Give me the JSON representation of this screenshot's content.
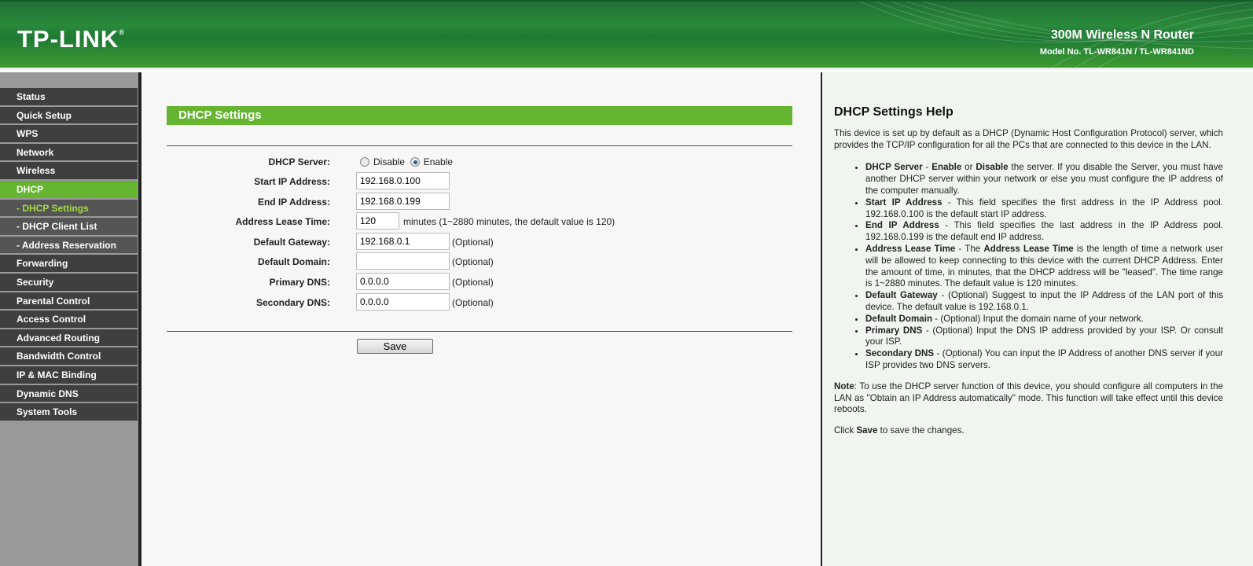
{
  "header": {
    "logo": "TP-LINK",
    "product": "300M Wireless N Router",
    "model": "Model No. TL-WR841N / TL-WR841ND",
    "brand_color": "#2a8a3a"
  },
  "sidebar": {
    "items": [
      {
        "label": "Status",
        "type": "main"
      },
      {
        "label": "Quick Setup",
        "type": "main"
      },
      {
        "label": "WPS",
        "type": "main"
      },
      {
        "label": "Network",
        "type": "main"
      },
      {
        "label": "Wireless",
        "type": "main"
      },
      {
        "label": "DHCP",
        "type": "active"
      },
      {
        "label": "- DHCP Settings",
        "type": "subactive"
      },
      {
        "label": "- DHCP Client List",
        "type": "sub"
      },
      {
        "label": "- Address Reservation",
        "type": "sub"
      },
      {
        "label": "Forwarding",
        "type": "main"
      },
      {
        "label": "Security",
        "type": "main"
      },
      {
        "label": "Parental Control",
        "type": "main"
      },
      {
        "label": "Access Control",
        "type": "main"
      },
      {
        "label": "Advanced Routing",
        "type": "main"
      },
      {
        "label": "Bandwidth Control",
        "type": "main"
      },
      {
        "label": "IP & MAC Binding",
        "type": "main"
      },
      {
        "label": "Dynamic DNS",
        "type": "main"
      },
      {
        "label": "System Tools",
        "type": "main"
      }
    ]
  },
  "main": {
    "title": "DHCP Settings",
    "dhcp_server": {
      "label": "DHCP Server:",
      "disable": "Disable",
      "enable": "Enable",
      "selected": "Enable"
    },
    "fields": {
      "start_ip": {
        "label": "Start IP Address:",
        "value": "192.168.0.100"
      },
      "end_ip": {
        "label": "End IP Address:",
        "value": "192.168.0.199"
      },
      "lease": {
        "label": "Address Lease Time:",
        "value": "120",
        "note": "minutes (1~2880 minutes, the default value is 120)"
      },
      "gateway": {
        "label": "Default Gateway:",
        "value": "192.168.0.1",
        "note": "(Optional)"
      },
      "domain": {
        "label": "Default Domain:",
        "value": "",
        "note": "(Optional)"
      },
      "dns1": {
        "label": "Primary DNS:",
        "value": "0.0.0.0",
        "note": "(Optional)"
      },
      "dns2": {
        "label": "Secondary DNS:",
        "value": "0.0.0.0",
        "note": "(Optional)"
      }
    },
    "save": "Save"
  },
  "help": {
    "title": "DHCP Settings Help",
    "intro": "This device is set up by default as a DHCP (Dynamic Host Configuration Protocol) server, which provides the TCP/IP configuration for all the PCs that are connected to this device in the LAN.",
    "items": [
      {
        "term": "DHCP Server",
        "a": " - ",
        "b1": "Enable",
        "m": " or ",
        "b2": "Disable",
        "text": " the server. If you disable the Server, you must have another DHCP server within your network or else you must configure the IP address of the computer manually."
      },
      {
        "term": "Start IP Address",
        "text": " - This field specifies the first address in the IP Address pool. 192.168.0.100 is the default start IP address."
      },
      {
        "term": "End IP Address",
        "text": " - This field specifies the last address in the IP Address pool. 192.168.0.199 is the default end IP address."
      },
      {
        "term": "Address Lease Time",
        "a": " - The ",
        "b1": "Address Lease Time",
        "text": " is the length of time a network user will be allowed to keep connecting to this device with the current DHCP Address. Enter the amount of time, in minutes, that the DHCP address will be \"leased\". The time range is 1~2880 minutes. The default value is 120 minutes."
      },
      {
        "term": "Default Gateway",
        "text": " - (Optional) Suggest to input the IP Address of the LAN port of this device. The default value is 192.168.0.1."
      },
      {
        "term": "Default Domain",
        "text": " - (Optional) Input the domain name of your network."
      },
      {
        "term": "Primary DNS",
        "text": " - (Optional) Input the DNS IP address provided by your ISP. Or consult your ISP."
      },
      {
        "term": "Secondary DNS",
        "text": " - (Optional) You can input the IP Address of another DNS server if your ISP provides two DNS servers."
      }
    ],
    "note_term": "Note",
    "note": ": To use the DHCP server function of this device, you should configure all computers in the LAN as \"Obtain an IP Address automatically\" mode. This function will take effect until this device reboots.",
    "click_a": "Click ",
    "click_b": "Save",
    "click_c": " to save the changes."
  }
}
